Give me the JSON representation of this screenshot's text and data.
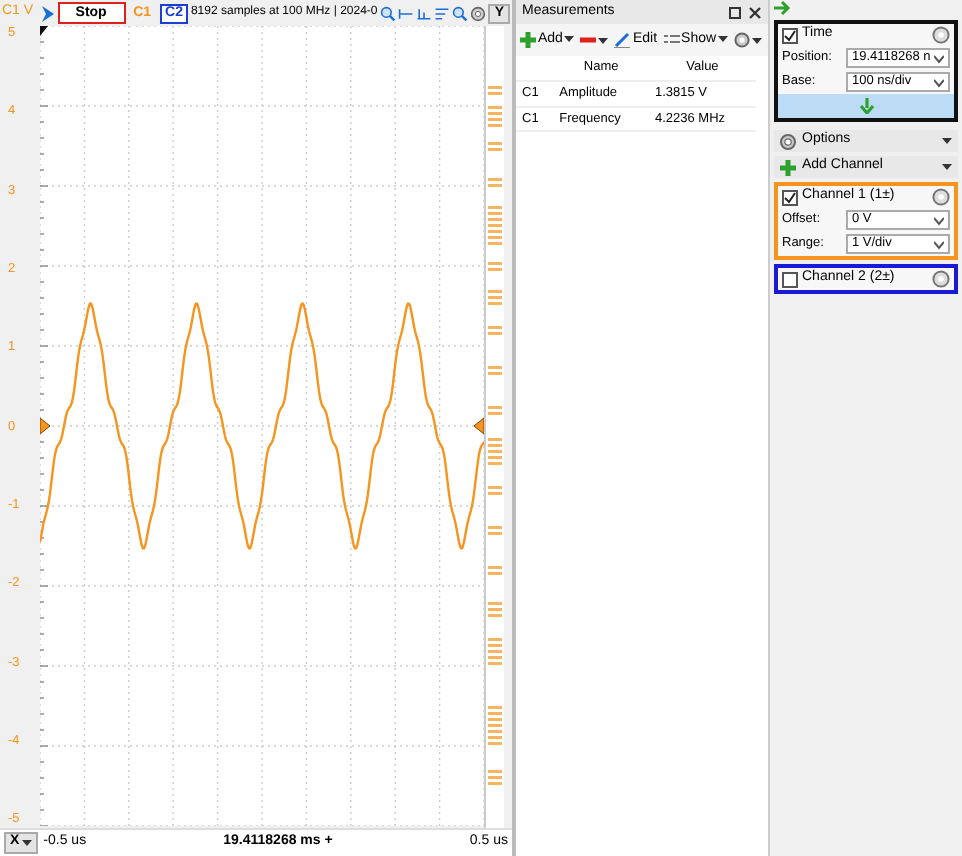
{
  "toolbar": {
    "axis_label": "C1 V",
    "stop_button": "Stop",
    "channel_buttons": [
      {
        "label": "C1",
        "selected": false,
        "color": "#f7941d"
      },
      {
        "label": "C2",
        "selected": true,
        "color": "#1a3fd6"
      }
    ],
    "info": "8192 samples at 100 MHz | 2024-0",
    "y_button": "Y"
  },
  "y_axis": {
    "labels": [
      "5",
      "4",
      "3",
      "2",
      "1",
      "0",
      "-1",
      "-2",
      "-3",
      "-4",
      "-5"
    ]
  },
  "x_axis": {
    "button": "X",
    "start": "-0.5 us",
    "center": "19.4118268 ms +",
    "end": "0.5 us"
  },
  "measurements": {
    "title": "Measurements",
    "tools": [
      {
        "kind": "add",
        "label": "Add"
      },
      {
        "kind": "remove"
      },
      {
        "kind": "edit",
        "label": "Edit"
      },
      {
        "kind": "show",
        "label": "Show"
      },
      {
        "kind": "settings"
      }
    ],
    "columns": [
      "Name",
      "Value"
    ],
    "rows": [
      {
        "channel": "C1",
        "name": "Amplitude",
        "value": "1.3815 V"
      },
      {
        "channel": "C1",
        "name": "Frequency",
        "value": "4.2236 MHz"
      }
    ]
  },
  "time": {
    "title": "Time",
    "checked": true,
    "position_label": "Position:",
    "position": "19.4118268 n",
    "base_label": "Base:",
    "base": "100 ns/div"
  },
  "options": "Options",
  "add_channel": "Add Channel",
  "channels": [
    {
      "name": "Channel 1 (1±)",
      "checked": true,
      "color": "#f7941d",
      "expanded": true,
      "offset_label": "Offset:",
      "offset": "0 V",
      "range_label": "Range:",
      "range": "1 V/div"
    },
    {
      "name": "Channel 2 (2±)",
      "checked": false,
      "color": "#1a1ad6",
      "expanded": false
    }
  ]
}
